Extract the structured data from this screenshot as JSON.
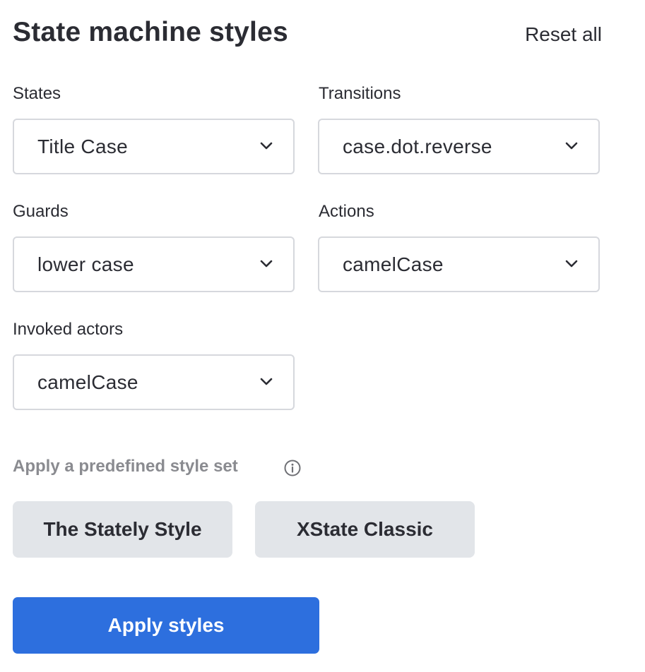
{
  "panel": {
    "title": "State machine styles",
    "reset_label": "Reset all"
  },
  "fields": {
    "states": {
      "label": "States",
      "value": "Title Case"
    },
    "transitions": {
      "label": "Transitions",
      "value": "case.dot.reverse"
    },
    "guards": {
      "label": "Guards",
      "value": "lower case"
    },
    "actions": {
      "label": "Actions",
      "value": "camelCase"
    },
    "invoked_actors": {
      "label": "Invoked actors",
      "value": "camelCase"
    }
  },
  "presets": {
    "label": "Apply a predefined style set",
    "info_icon": "info-circle-icon",
    "items": [
      {
        "label": "The Stately Style"
      },
      {
        "label": "XState Classic"
      }
    ]
  },
  "apply_label": "Apply styles",
  "colors": {
    "primary": "#2d6fde",
    "preset_bg": "#e2e5e9",
    "border": "#d6d8dd",
    "text": "#2b2c33",
    "muted": "#8a8b90"
  }
}
